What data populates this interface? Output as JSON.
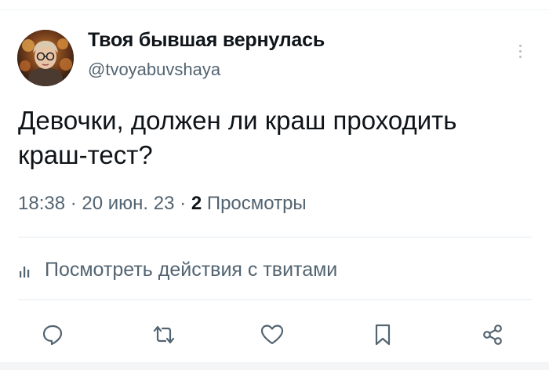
{
  "author": {
    "display_name": "Твоя бывшая вернулась",
    "handle": "@tvoyabuvshaya"
  },
  "tweet": {
    "text_line1": "Девочки, должен ли краш проходить",
    "text_line2": "краш-тест?"
  },
  "meta": {
    "time": "18:38",
    "separator": "·",
    "date": "20 июн. 23",
    "views_count": "2",
    "views_label": "Просмотры"
  },
  "activity": {
    "icon": "analytics-icon",
    "label": "Посмотреть действия с твитами"
  },
  "actions": [
    {
      "icon": "reply-icon"
    },
    {
      "icon": "retweet-icon"
    },
    {
      "icon": "like-icon"
    },
    {
      "icon": "bookmark-icon"
    },
    {
      "icon": "share-icon"
    }
  ],
  "colors": {
    "text_primary": "#0f1419",
    "text_secondary": "#536471",
    "divider": "#e6ecf0"
  }
}
